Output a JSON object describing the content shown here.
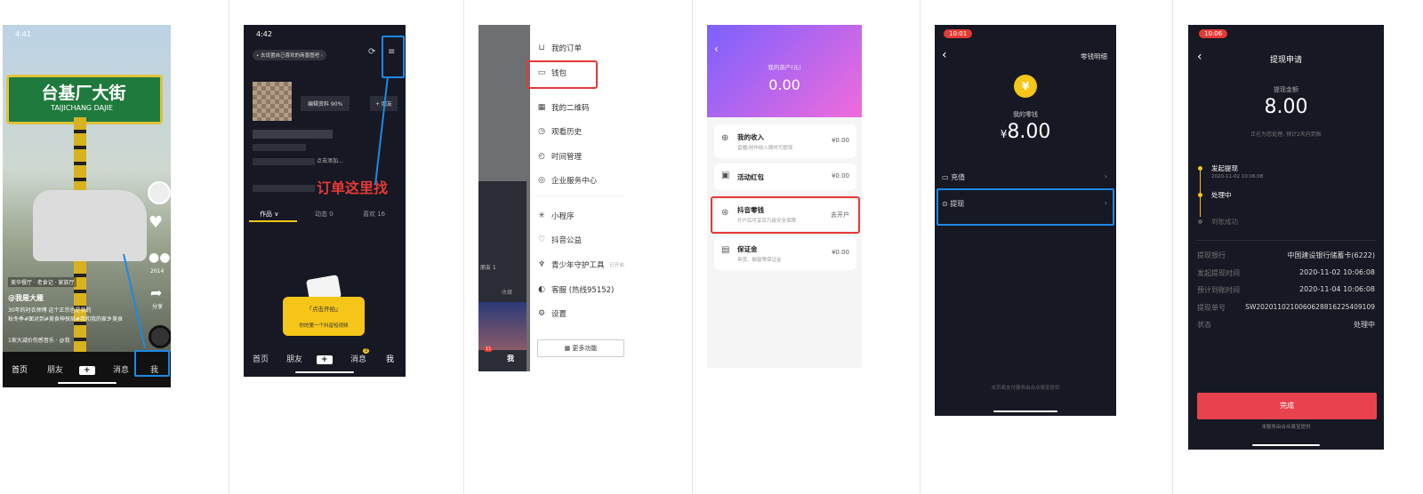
{
  "p1": {
    "status_time": "4:41",
    "sign_cn": "台基厂大街",
    "sign_en": "TAIJICHANG DAJIE",
    "side_count": "2014",
    "side_share": "分享",
    "tag_text": "美华餐厅 · 老食记 · 家族厅",
    "author": "@我是大雁",
    "caption_1": "30年的衬衣师傅 这个正宗也是我的",
    "caption_2": "秋冬季#面对到#美食神探局#我和我的家乡美食",
    "music": "1家大减价伤感音乐 · @我",
    "tabs": [
      "首页",
      "朋友",
      "+",
      "消息",
      "我"
    ]
  },
  "p2": {
    "status_time": "4:42",
    "banner": "• 去设置自己喜欢的商香图吧 ›",
    "edit_profile": "编辑资料 90%",
    "add_friend": "+ 朋友",
    "add_hint": "点击添加...",
    "annotation": "订单这里找",
    "profile_tabs": [
      "作品 ∨",
      "动态 0",
      "喜欢 16"
    ],
    "bubble_title": "「点击开拍」",
    "bubble_sub": "你的第一个抖音短视频",
    "tabs": [
      "首页",
      "朋友",
      "+",
      "消息",
      "我"
    ],
    "msg_badge": "3"
  },
  "p3": {
    "menu": [
      {
        "icon": "cart-icon",
        "glyph": "⊔",
        "label": "我的订单"
      },
      {
        "icon": "wallet-icon",
        "glyph": "▭",
        "label": "钱包"
      },
      {
        "icon": "qrcode-icon",
        "glyph": "▦",
        "label": "我的二维码"
      },
      {
        "icon": "history-icon",
        "glyph": "◷",
        "label": "观看历史"
      },
      {
        "icon": "timer-icon",
        "glyph": "◴",
        "label": "时间管理"
      },
      {
        "icon": "enterprise-icon",
        "glyph": "◎",
        "label": "企业服务中心"
      },
      {
        "icon": "miniapp-icon",
        "glyph": "✳",
        "label": "小程序"
      },
      {
        "icon": "charity-icon",
        "glyph": "♡",
        "label": "抖音公益"
      },
      {
        "icon": "youth-icon",
        "glyph": "♆",
        "label": "青少年守护工具"
      },
      {
        "icon": "service-icon",
        "glyph": "◐",
        "label": "客服 (热线95152)"
      },
      {
        "icon": "settings-icon",
        "glyph": "⚙",
        "label": "设置"
      }
    ],
    "youth_status": "已开启",
    "more": "更多功能",
    "left_friend": "朋友 1",
    "left_collect": "收藏",
    "left_me": "我",
    "left_badge": "11"
  },
  "p4": {
    "header_label": "我的资产(元)",
    "header_value": "0.00",
    "rows": [
      {
        "icon": "income-icon",
        "glyph": "⊕",
        "title": "我的收入",
        "sub": "直播/创作收入随时可提现",
        "value": "¥0.00"
      },
      {
        "icon": "redpacket-icon",
        "glyph": "▣",
        "title": "活动红包",
        "sub": "",
        "value": "¥0.00"
      },
      {
        "icon": "change-icon",
        "glyph": "⊛",
        "title": "抖音零钱",
        "sub": "开户后可享百万级安全保障",
        "value": "去开户"
      },
      {
        "icon": "deposit-icon",
        "glyph": "▤",
        "title": "保证金",
        "sub": "带货、橱窗等保证金",
        "value": "¥0.00"
      }
    ]
  },
  "p5": {
    "status_time": "10:01",
    "detail_link": "零钱明细",
    "coin": "¥",
    "label": "我的零钱",
    "currency": "¥",
    "amount": "8.00",
    "rows": [
      {
        "icon": "card-icon",
        "glyph": "▭",
        "label": "充值"
      },
      {
        "icon": "withdraw-icon",
        "glyph": "⊙",
        "label": "提现"
      }
    ],
    "footer": "本页面支付服务由合众易宝提供"
  },
  "p6": {
    "status_time": "10:06",
    "title": "提现申请",
    "amount_label": "提现金额",
    "amount": "8.00",
    "processing_note": "正在为您处理, 预计2天内到账",
    "steps": [
      {
        "label": "发起提现",
        "date": "2020-11-02 10:06:08"
      },
      {
        "label": "处理中",
        "date": ""
      },
      {
        "label": "到账成功",
        "date": ""
      }
    ],
    "details": [
      {
        "label": "提现银行",
        "value": "中国建设银行储蓄卡(6222)"
      },
      {
        "label": "发起提现时间",
        "value": "2020-11-02 10:06:08"
      },
      {
        "label": "预计到账时间",
        "value": "2020-11-04 10:06:08"
      },
      {
        "label": "提现单号",
        "value": "SW2020110210060628816225409109"
      },
      {
        "label": "状态",
        "value": "处理中"
      }
    ],
    "done": "完成",
    "footer": "本服务由合众易宝提供"
  },
  "colors": {
    "highlight_blue": "#1e88e5",
    "highlight_red": "#e53935",
    "accent_red": "#e8424f",
    "wallet_gradient_start": "#7b61ff",
    "wallet_gradient_end": "#f06bdc",
    "dark_bg": "#161823",
    "coin_yellow": "#f5c518"
  }
}
